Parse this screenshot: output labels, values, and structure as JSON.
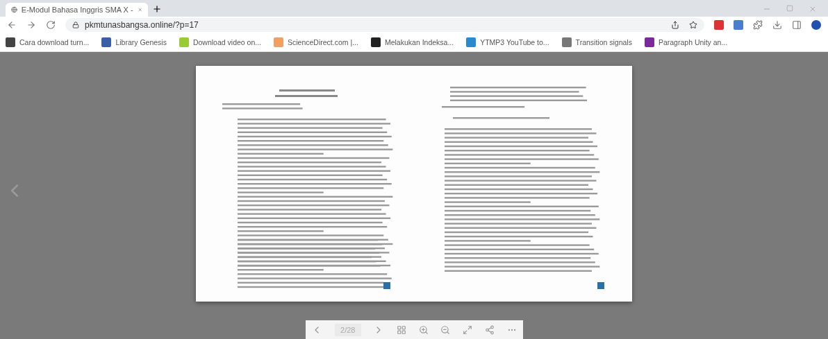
{
  "tabs": [
    {
      "title": "E-Modul Bahasa Inggris SMA X -",
      "selected": true
    }
  ],
  "address_bar": {
    "url": "pkmtunasbangsa.online/?p=17"
  },
  "bookmarks": [
    "Cara download turn...",
    "Library Genesis",
    "Download video on...",
    "ScienceDirect.com |...",
    "Melakukan Indeksa...",
    "YTMP3 YouTube to...",
    "Transition signals",
    "Paragraph Unity an..."
  ],
  "viewer": {
    "page_indicator": "2/28"
  }
}
